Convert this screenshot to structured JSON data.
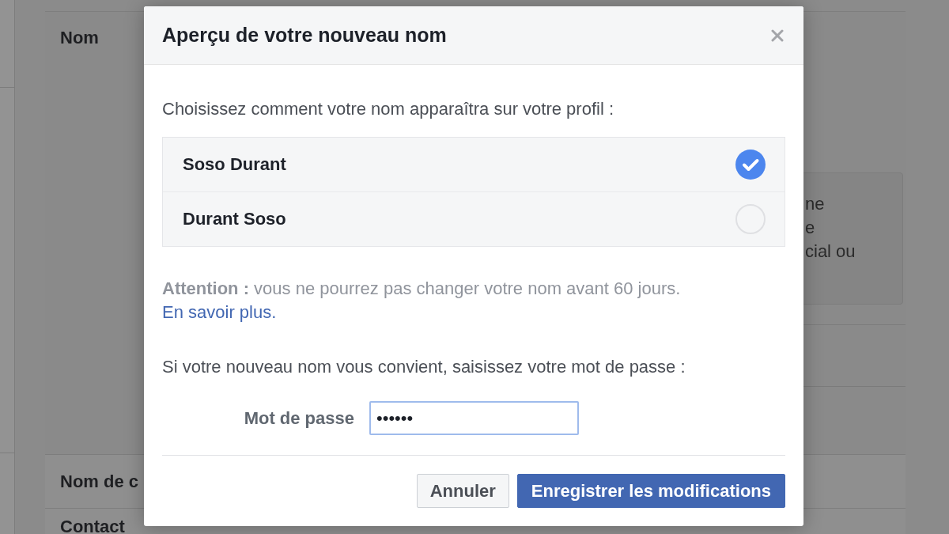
{
  "background_page": {
    "name_section": {
      "label": "Nom",
      "hint_lines": [
        "ne",
        "e",
        "cial ou"
      ]
    },
    "rows": [
      {
        "label": "Nom de c"
      },
      {
        "label": "Contact"
      }
    ]
  },
  "dialog": {
    "title": "Aperçu de votre nouveau nom",
    "prompt": "Choisissez comment votre nom apparaîtra sur votre profil :",
    "options": [
      {
        "label": "Soso Durant",
        "selected": true
      },
      {
        "label": "Durant Soso",
        "selected": false
      }
    ],
    "warning": {
      "text": "**Attention :** vous ne pourrez pas changer votre nom avant 60 jours.",
      "link": "En savoir plus."
    },
    "password_prompt": "Si votre nouveau nom vous convient, saisissez votre mot de passe :",
    "password": {
      "label": "Mot de passe",
      "value": "••••••",
      "focused": true
    },
    "buttons": [
      {
        "label": "Annuler",
        "kind": "secondary"
      },
      {
        "label": "Enregistrer les modifications",
        "kind": "primary"
      }
    ]
  }
}
